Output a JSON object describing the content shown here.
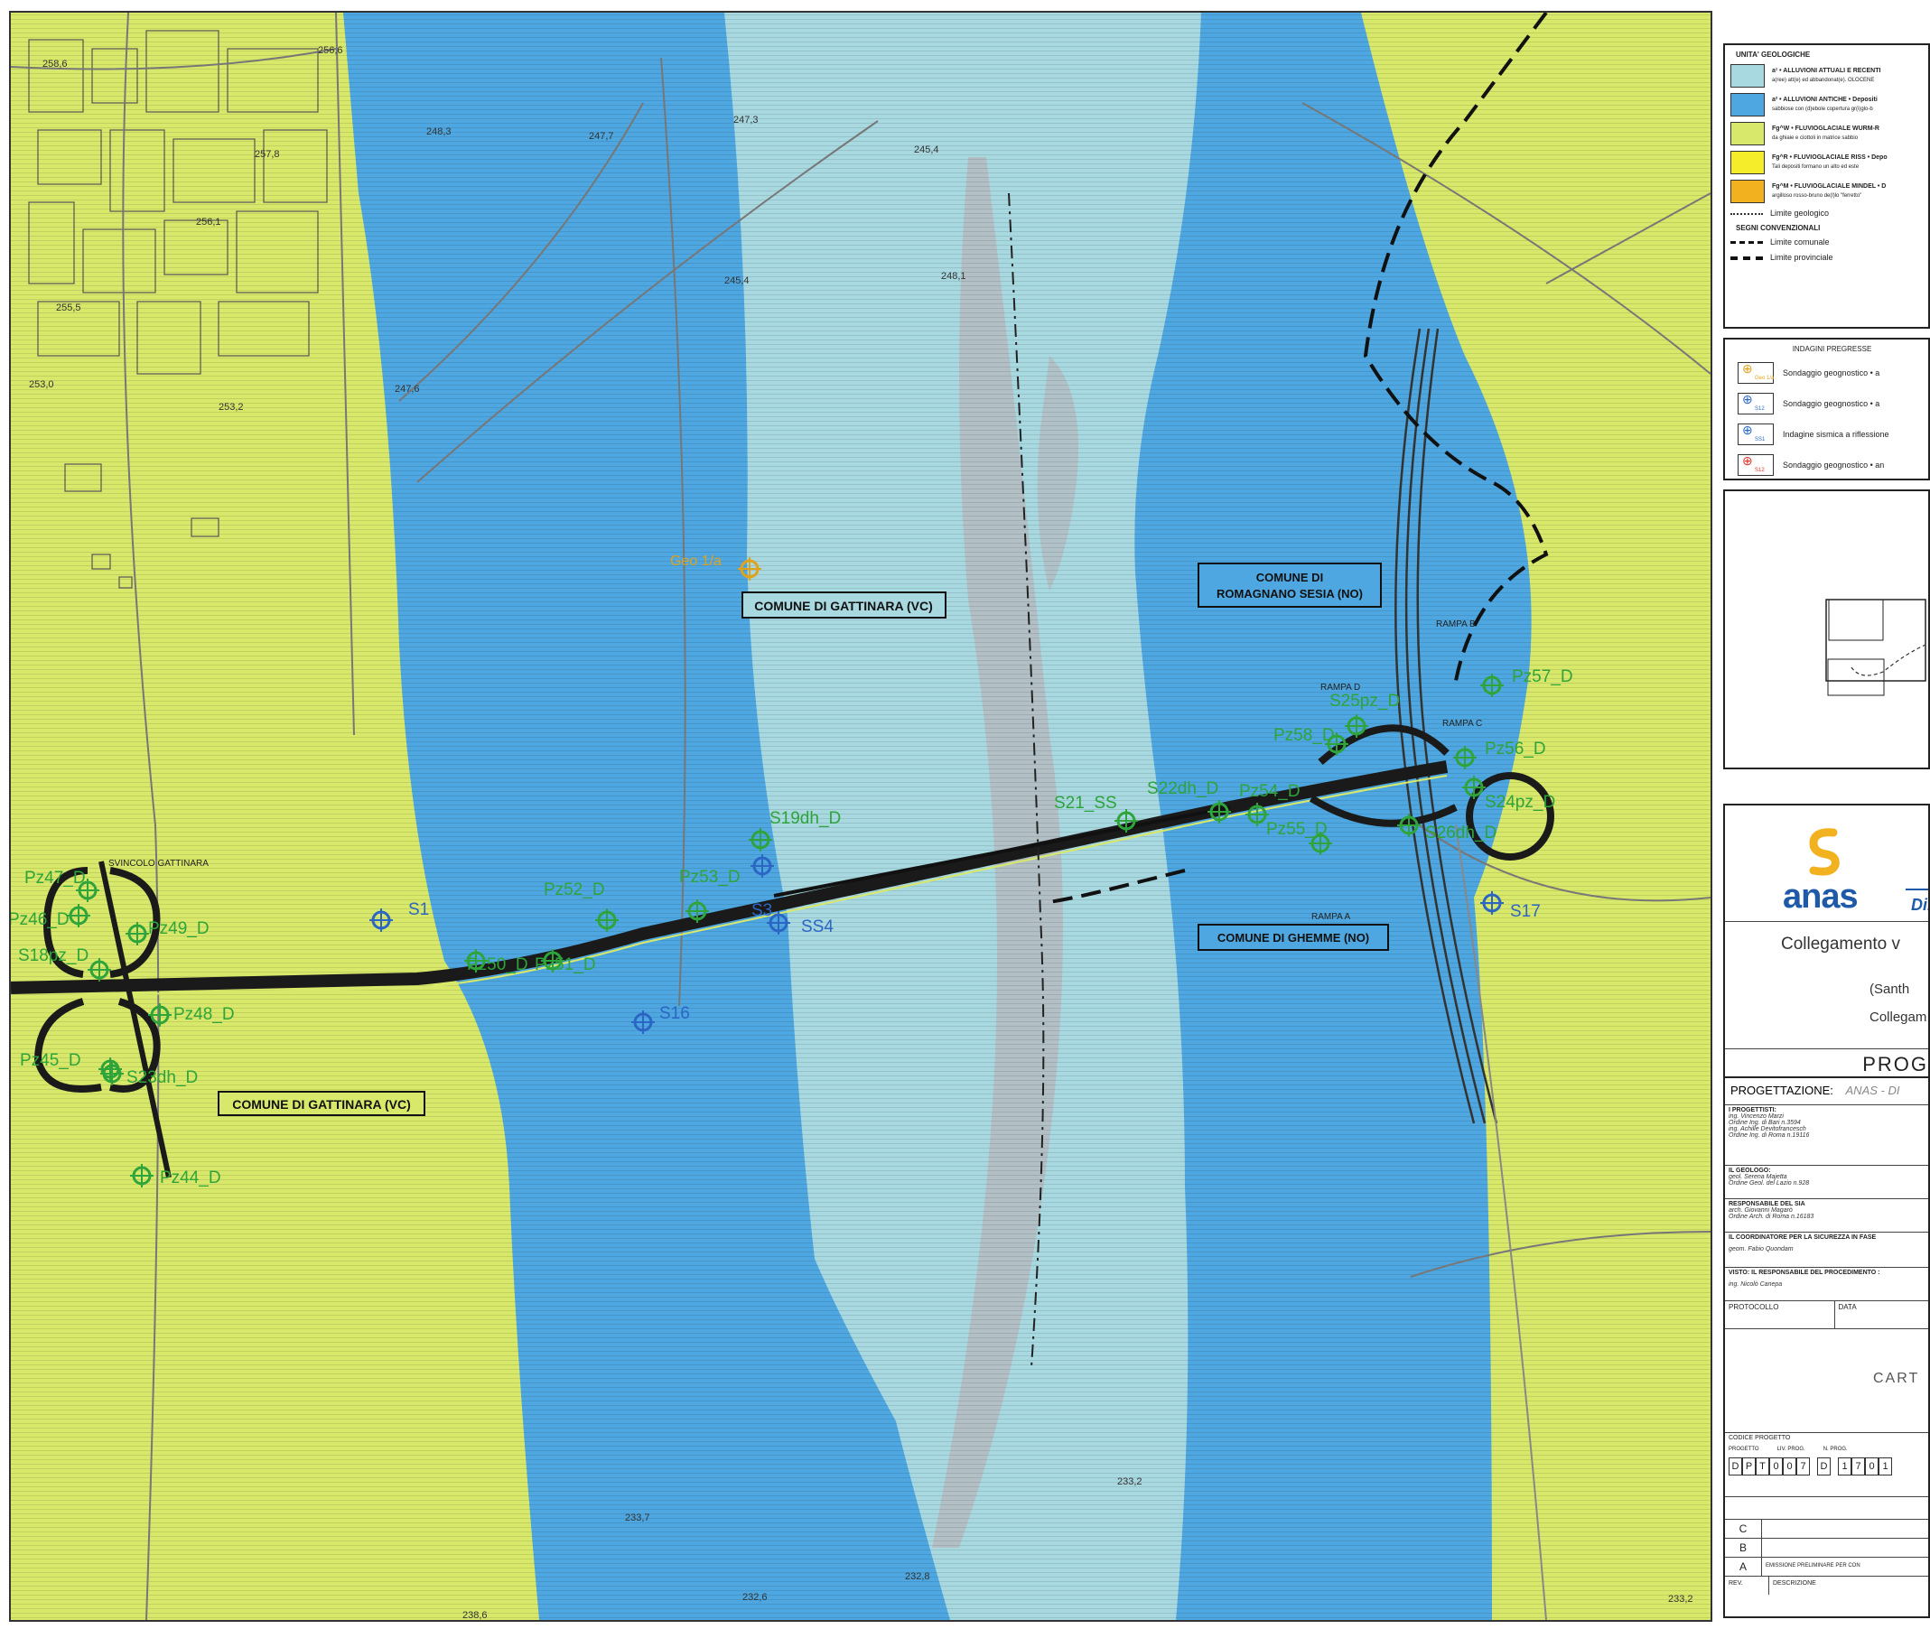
{
  "map": {
    "colors": {
      "fg_wurm": "#d8e86a",
      "alluvioni_antiche": "#4ea7e0",
      "alluvioni_attuali": "#a8d8e0",
      "road": "#1a1a1a",
      "borehole_green": "#2ea43a",
      "borehole_blue": "#2b66c4",
      "borehole_orange": "#e0a21a"
    },
    "labels": {
      "comune_gattinara_1": "COMUNE DI GATTINARA (VC)",
      "comune_gattinara_2": "COMUNE DI GATTINARA (VC)",
      "comune_romagnano_1": "COMUNE DI",
      "comune_romagnano_2": "ROMAGNANO SESIA (NO)",
      "comune_ghemme": "COMUNE DI GHEMME (NO)",
      "svincolo_gattinara": "SVINCOLO GATTINARA",
      "geo_label": "Geo 1/a"
    },
    "boreholes": [
      "Pz47_D",
      "Pz46_D",
      "Pz49_D",
      "S18pz_D",
      "Pz48_D",
      "Pz45_D",
      "S23dh_D",
      "Pz44_D",
      "S1",
      "Pz52_D",
      "Pz53_D",
      "S19dh_D",
      "S3",
      "SS4",
      "S16",
      "S21_SS",
      "S22dh_D",
      "Pz54_D",
      "Pz55_D",
      "Pz58_D",
      "S25pz_D",
      "Pz57_D",
      "Pz56_D",
      "S24pz_D",
      "S26dh_D",
      "S17",
      "Pz50_D",
      "Pz51_D"
    ],
    "elevations": [
      "258,6",
      "257,8",
      "256,1",
      "253,0",
      "253,2",
      "248,3",
      "247,7",
      "247,3",
      "245,4",
      "248,1",
      "245,4",
      "233,2",
      "233,7",
      "232,8",
      "232,6",
      "238,6",
      "233,2",
      "256,6",
      "255,5",
      "247,6"
    ],
    "ramps": [
      "RAMPA B",
      "RAMPA C",
      "RAMPA D",
      "RAMPA A"
    ]
  },
  "legend": {
    "title_units": "UNITA' GEOLOGICHE",
    "units": [
      {
        "label": "a¹ • ALLUVIONI ATTUALI E RECENTI",
        "sub": "a(ree) att(e) ed abbandonat(e). OLOCENE",
        "color": "#a8d8e0"
      },
      {
        "label": "a² • ALLUVIONI ANTICHE • Depositi",
        "sub": "sabbiose con (d)ebole copertura gr(i)glo-b",
        "color": "#4ea7e0"
      },
      {
        "label": "Fg^W • FLUVIOGLACIALE WURM-R",
        "sub": "da ghiaie e ciottoli in matrice sabbio",
        "color": "#d8e86a"
      },
      {
        "label": "Fg^R • FLUVIOGLACIALE RISS • Depo",
        "sub": "Tali depositi formano un alto ed este",
        "color": "#f5ec2a"
      },
      {
        "label": "Fg^M • FLUVIOGLACIALE MINDEL • D",
        "sub": "argilloso rosso-bruno de(l)lo \"ferretto\"",
        "color": "#f2b11e"
      }
    ],
    "limit_geo": "Limite geologico",
    "title_signs": "SEGNI CONVENZIONALI",
    "limit_comunale": "Limite comunale",
    "limit_provinciale": "Limite provinciale",
    "title_indagini": "INDAGINI PREGRESSE",
    "indagini": [
      {
        "label": "Sondaggio geognostico • a",
        "tag": "Geo 1/a",
        "color": "#e0a21a"
      },
      {
        "label": "Sondaggio geognostico • a",
        "tag": "S12",
        "color": "#2b66c4"
      },
      {
        "label": "Indagine sismica a riflessione",
        "tag": "SS1",
        "color": "#2b66c4"
      },
      {
        "label": "Sondaggio geognostico • an",
        "tag": "S12",
        "color": "#e0322a"
      }
    ]
  },
  "titleblock": {
    "brand": "anas",
    "brand_sub": "Dir",
    "project_line1": "Collegamento v",
    "project_line2": "(Santh",
    "project_line3": "Collegam",
    "phase": "PROG",
    "progettazione_label": "PROGETTAZIONE:",
    "progettazione_value": "ANAS - DI",
    "progettisti_label": "I PROGETTISTI:",
    "progettisti": [
      "ing. Vincenzo Marzi",
      "Ordine Ing. di Bari n.3594",
      "ing. Achille Devitofrancesch",
      "Ordine Ing. di Roma n.19116"
    ],
    "geologo_label": "IL GEOLOGO:",
    "geologo": [
      "geol. Serena Majetta",
      "Ordine Geol. del Lazio n.928"
    ],
    "sia_label": "RESPONSABILE DEL SIA",
    "sia": [
      "arch. Giovanni Magarò",
      "Ordine Arch. di Roma n.16183"
    ],
    "coordinatore": "IL COORDINATORE PER LA SICUREZZA IN FASE",
    "coordinatore_name": "geom. Fabio Quondam",
    "visto": "VISTO: IL RESPONSABILE DEL PROCEDIMENTO :",
    "visto_name": "ing. Nicolò Canepa",
    "protocollo": "PROTOCOLLO",
    "data": "DATA",
    "carta": "CART",
    "codice_label": "CODICE PROGETTO",
    "codice_sub": [
      "PROGETTO",
      "LIV. PROG.",
      "N. PROG."
    ],
    "codice_cells": [
      "D",
      "P",
      "T",
      "0",
      "0",
      "7",
      "D",
      "1",
      "7",
      "0",
      "1"
    ],
    "revisions": [
      {
        "rev": "C",
        "desc": ""
      },
      {
        "rev": "B",
        "desc": ""
      },
      {
        "rev": "A",
        "desc": "EMISSIONE PRELIMINARE PER CON"
      }
    ],
    "rev_label": "REV.",
    "desc_label": "DESCRIZIONE"
  }
}
